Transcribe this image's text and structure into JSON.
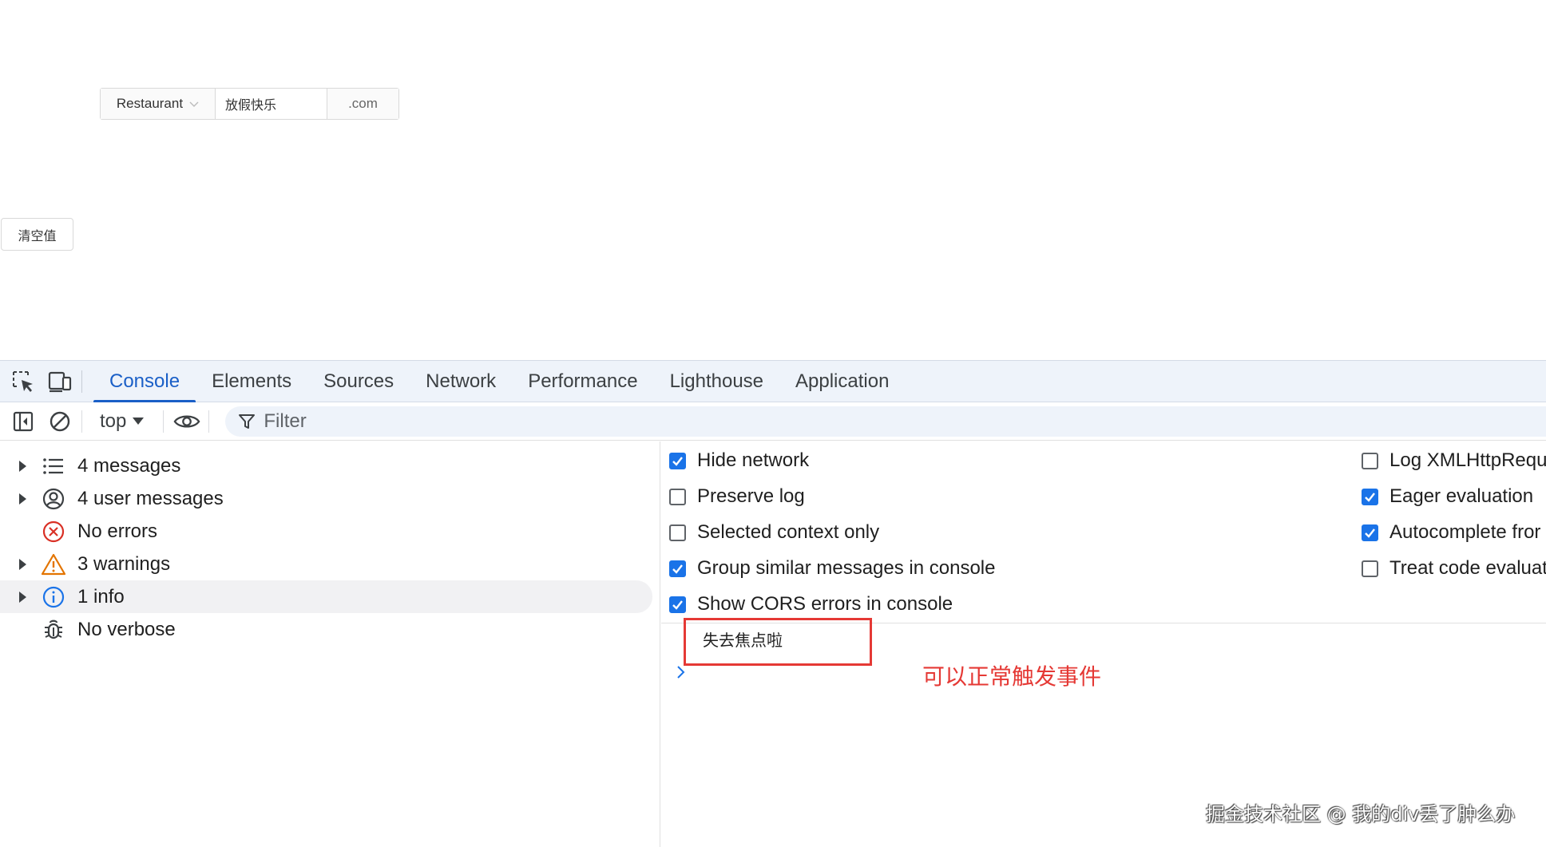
{
  "page": {
    "select_value": "Restaurant",
    "input_value": "放假快乐",
    "suffix": ".com",
    "clear_button": "清空值"
  },
  "devtools": {
    "tabs": [
      "Console",
      "Elements",
      "Sources",
      "Network",
      "Performance",
      "Lighthouse",
      "Application"
    ],
    "active_tab": "Console",
    "toolbar": {
      "context": "top",
      "filter_placeholder": "Filter"
    },
    "sidebar": [
      {
        "label": "4 messages",
        "icon": "list-icon",
        "expandable": true
      },
      {
        "label": "4 user messages",
        "icon": "user-circle-icon",
        "expandable": true
      },
      {
        "label": "No errors",
        "icon": "error-icon",
        "expandable": false
      },
      {
        "label": "3 warnings",
        "icon": "warning-icon",
        "expandable": true
      },
      {
        "label": "1 info",
        "icon": "info-icon",
        "expandable": true,
        "selected": true
      },
      {
        "label": "No verbose",
        "icon": "bug-icon",
        "expandable": false
      }
    ],
    "settings_left": [
      {
        "label": "Hide network",
        "checked": true
      },
      {
        "label": "Preserve log",
        "checked": false
      },
      {
        "label": "Selected context only",
        "checked": false
      },
      {
        "label": "Group similar messages in console",
        "checked": true
      },
      {
        "label": "Show CORS errors in console",
        "checked": true
      }
    ],
    "settings_right": [
      {
        "label": "Log XMLHttpRequ",
        "checked": false
      },
      {
        "label": "Eager evaluation",
        "checked": true
      },
      {
        "label": "Autocomplete fror",
        "checked": true
      },
      {
        "label": "Treat code evaluat",
        "checked": false
      }
    ],
    "console_message": "失去焦点啦"
  },
  "annotation": "可以正常触发事件",
  "watermark": "掘金技术社区 @ 我的div丢了肿么办",
  "colors": {
    "accent": "#1a5fc7",
    "checkbox": "#1a73e8",
    "annotation_red": "#e53935",
    "tabbar_bg": "#eef3fa"
  }
}
